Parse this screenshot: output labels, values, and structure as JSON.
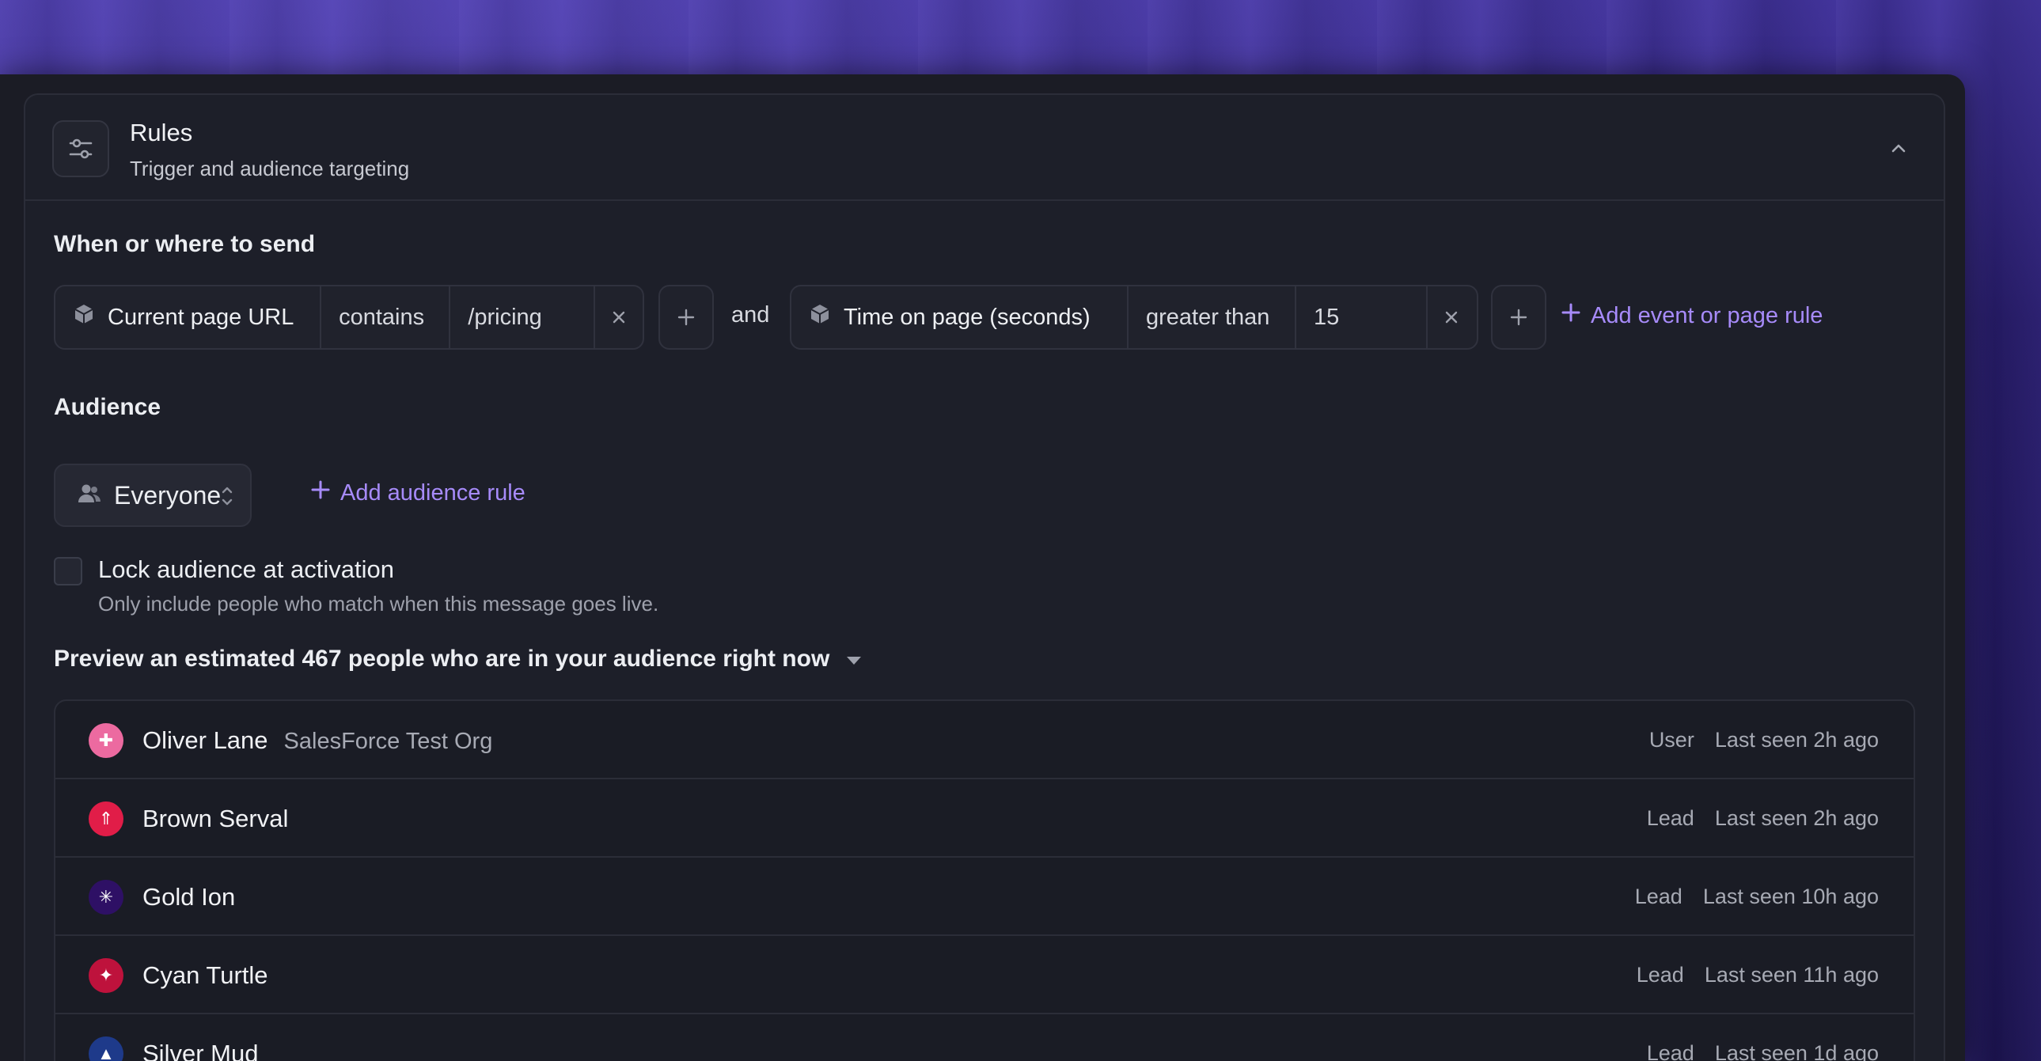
{
  "header": {
    "title": "Rules",
    "subtitle": "Trigger and audience targeting"
  },
  "when": {
    "title": "When or where to send",
    "rule1": {
      "field": "Current page URL",
      "operator": "contains",
      "value": "/pricing"
    },
    "joiner": "and",
    "rule2": {
      "field": "Time on page (seconds)",
      "operator": "greater than",
      "value": "15"
    },
    "add_label": "Add event or page rule"
  },
  "audience": {
    "title": "Audience",
    "selected": "Everyone",
    "add_label": "Add audience rule",
    "lock_label": "Lock audience at activation",
    "lock_help": "Only include people who match when this message goes live.",
    "lock_checked": false
  },
  "preview": {
    "title": "Preview an estimated 467 people who are in your audience right now"
  },
  "people": [
    {
      "name": "Oliver Lane",
      "org": "SalesForce Test Org",
      "type": "User",
      "seen": "Last seen 2h ago",
      "color": "#ec6aa0",
      "glyph": "✚"
    },
    {
      "name": "Brown Serval",
      "org": "",
      "type": "Lead",
      "seen": "Last seen 2h ago",
      "color": "#e11d48",
      "glyph": "⇑"
    },
    {
      "name": "Gold Ion",
      "org": "",
      "type": "Lead",
      "seen": "Last seen 10h ago",
      "color": "#2e1065",
      "glyph": "✳"
    },
    {
      "name": "Cyan Turtle",
      "org": "",
      "type": "Lead",
      "seen": "Last seen 11h ago",
      "color": "#be123c",
      "glyph": "✦"
    },
    {
      "name": "Silver Mud",
      "org": "",
      "type": "Lead",
      "seen": "Last seen 1d ago",
      "color": "#1e3a8a",
      "glyph": "▲"
    }
  ],
  "colors": {
    "accent": "#a78bfa",
    "panel": "#1d1f29",
    "border": "#2b2d38"
  }
}
